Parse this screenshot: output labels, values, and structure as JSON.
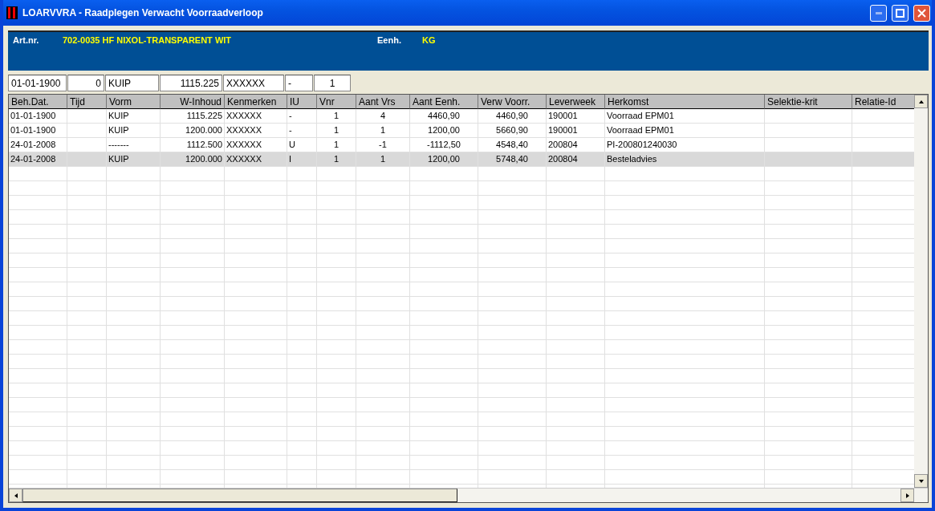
{
  "window": {
    "title": "LOARVVRA - Raadplegen Verwacht Voorraadverloop"
  },
  "header": {
    "article_label": "Art.nr.",
    "article_value": "702-0035  HF NIXOL-TRANSPARENT WIT",
    "unit_label": "Eenh.",
    "unit_value": "KG"
  },
  "filters": [
    "01-01-1900",
    "0",
    "KUIP",
    "1115.225",
    "XXXXXX",
    "-",
    "1"
  ],
  "table": {
    "columns": [
      "Beh.Dat.",
      "Tijd",
      "Vorm",
      "W-Inhoud",
      "Kenmerken",
      "IU",
      "Vnr",
      "Aant Vrs",
      "Aant Eenh.",
      "Verw Voorr.",
      "Leverweek",
      "Herkomst",
      "Selektie-krit",
      "Relatie-Id"
    ],
    "rows": [
      {
        "selected": false,
        "cells": [
          "01-01-1900",
          "",
          "KUIP",
          "1115.225",
          "XXXXXX",
          "-",
          "1",
          "4",
          "4460,90",
          "4460,90",
          "190001",
          "Voorraad EPM01",
          "",
          ""
        ]
      },
      {
        "selected": false,
        "cells": [
          "01-01-1900",
          "",
          "KUIP",
          "1200.000",
          "XXXXXX",
          "-",
          "1",
          "1",
          "1200,00",
          "5660,90",
          "190001",
          "Voorraad EPM01",
          "",
          ""
        ]
      },
      {
        "selected": false,
        "cells": [
          "24-01-2008",
          "",
          "-------",
          "1112.500",
          "XXXXXX",
          "U",
          "1",
          "-1",
          "-1112,50",
          "4548,40",
          "200804",
          "PI-200801240030",
          "",
          ""
        ]
      },
      {
        "selected": true,
        "cells": [
          "24-01-2008",
          "",
          "KUIP",
          "1200.000",
          "XXXXXX",
          "I",
          "1",
          "1",
          "1200,00",
          "5748,40",
          "200804",
          "Besteladvies",
          "",
          ""
        ]
      }
    ]
  }
}
